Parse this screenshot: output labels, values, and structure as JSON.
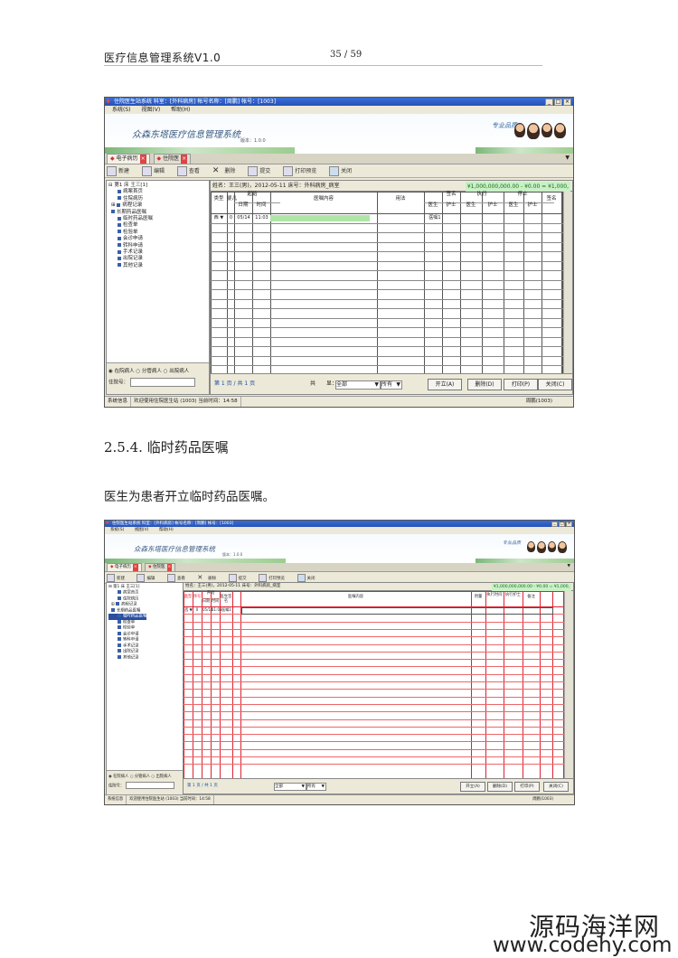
{
  "page_header": {
    "title": "医疗信息管理系统V1.0",
    "page": "35 / 59"
  },
  "shot1": {
    "title": "住院医生站系统 科室：[外科病房] 帐号名称：[周鹏] 帐号：[1003]",
    "menu": [
      "系统(S)",
      "视图(V)",
      "帮助(H)"
    ],
    "banner": "众森东塔医疗信息管理系统",
    "banner_small": "版本：1.0.0",
    "slogan": "专业品质",
    "tabs": [
      "电子病历",
      "住院医"
    ],
    "toolbar": [
      "新建",
      "编辑",
      "查看",
      "删除",
      "提交",
      "打印预览",
      "关闭"
    ],
    "tree_root": "第1 床 王三[1]",
    "tree_items": [
      "病案首页",
      "住院病历",
      "病程记录",
      "长期药品医嘱",
      "临时药品医嘱",
      "检查单",
      "检验单",
      "会诊申请",
      "转科申请",
      "手术记录",
      "出院记录",
      "其他记录"
    ],
    "radio": [
      "在院病人",
      "分管病人",
      "出院病人"
    ],
    "search_label": "住院号：",
    "info": "姓名：王三(男)，2012-05-11   床号：外科病房_病室",
    "money": "¥1,000,000,000.00 - ¥0.00 = ¥1,000,",
    "headers": [
      "类型",
      "婴儿",
      "起始",
      "日期",
      "时间",
      "医嘱内容",
      "用法",
      "医生",
      "护士",
      "签名",
      "执行",
      "停止",
      "医生",
      "护士",
      "签名"
    ],
    "row": {
      "type": "西",
      "no": "0",
      "date": "05/14",
      "time": "11:03",
      "flag": "医嘱1"
    },
    "footer_page": "第 1 页 / 共 1 页",
    "footer_sel1": "全部",
    "footer_sel2": "所有",
    "footer_btns": [
      "开立(A)",
      "删除(D)",
      "打印(P)",
      "关闭(C)"
    ],
    "status": [
      "系统信息",
      "欢迎使用住院医生站 (1003) 当前时间：14:58",
      "周鹏(1003)"
    ]
  },
  "section_title": "2.5.4. 临时药品医嘱",
  "section_text": "医生为患者开立临时药品医嘱。",
  "shot2": {
    "title": "住院医生站系统 科室：[外科病房] 帐号名称：[周鹏] 帐号：[1003]",
    "menu": [
      "系统(S)",
      "视图(V)",
      "帮助(H)"
    ],
    "banner": "众森东塔医疗信息管理系统",
    "banner_small": "版本：1.0.0",
    "slogan": "专业品质",
    "tabs": [
      "电子病历",
      "住院医"
    ],
    "toolbar": [
      "新建",
      "编辑",
      "查看",
      "删除",
      "提交",
      "打印预览",
      "关闭"
    ],
    "tree_root": "第1 床 王三[1]",
    "tree_items": [
      "病案首页",
      "住院病历",
      "病程记录",
      "长期药品医嘱",
      "临时药品医嘱",
      "检查单",
      "检验单",
      "会诊申请",
      "转科申请",
      "手术记录",
      "出院记录",
      "其他记录"
    ],
    "radio": [
      "在院病人",
      "分管病人",
      "出院病人"
    ],
    "search_label": "住院号：",
    "info": "姓名：王三(男)，2012-05-11   床号：外科病房_病室",
    "money": "¥1,000,000,000.00 - ¥0.00 = ¥1,000,",
    "headers": [
      "类型",
      "序号",
      "开始",
      "日期",
      "时间",
      "医嘱内容",
      "用量",
      "执行时间",
      "执行护士",
      "备注",
      "医生签名"
    ],
    "row": {
      "type": "西",
      "no": "0",
      "date": "05/14",
      "time": "11:03",
      "flag": "医嘱1"
    },
    "footer_page": "第 1 页 / 共 1 页",
    "footer_sel1": "全部",
    "footer_sel2": "所有",
    "footer_btns": [
      "开立(A)",
      "删除(D)",
      "打印(P)",
      "关闭(C)"
    ],
    "status": [
      "系统信息",
      "欢迎使用住院医生站 (1003) 当前时间：14:58",
      "周鹏(1003)"
    ]
  },
  "watermark": {
    "name": "源码海洋网",
    "url": "www.codehy.com"
  }
}
